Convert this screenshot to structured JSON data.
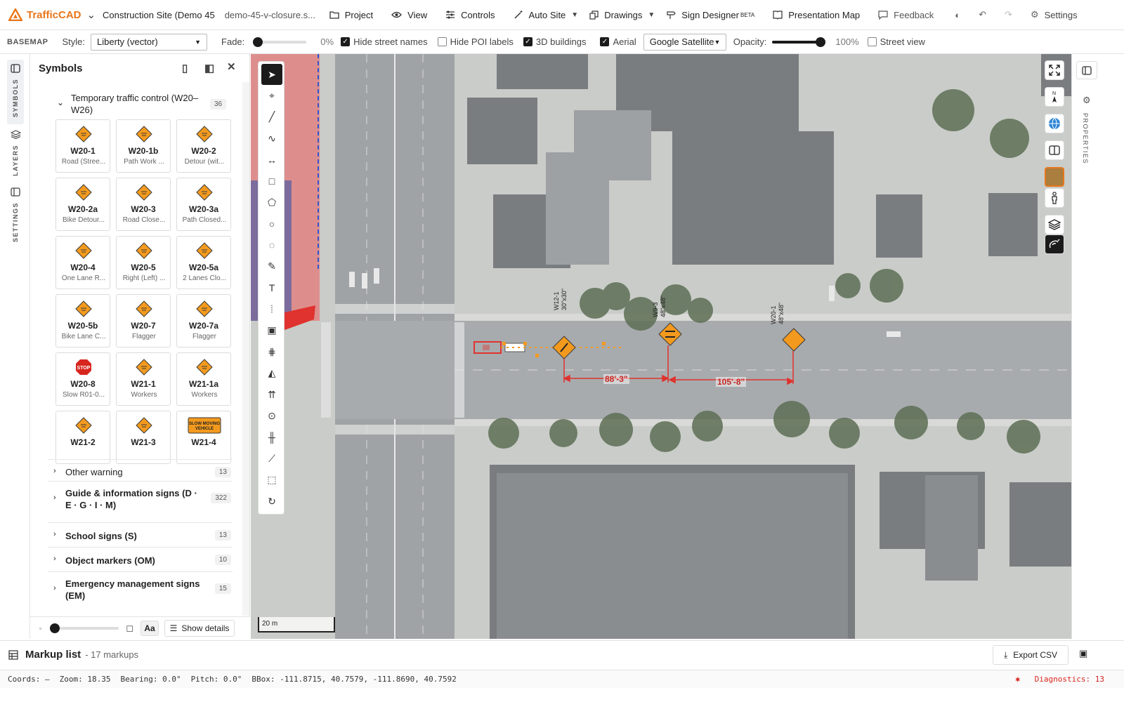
{
  "app": {
    "name": "TrafficCAD",
    "project_title": "Construction Site (Demo 45",
    "project_file": "demo-45-v-closure.s..."
  },
  "menu": [
    {
      "label": "Project",
      "icon": "folder-icon"
    },
    {
      "label": "View",
      "icon": "eye-icon"
    },
    {
      "label": "Controls",
      "icon": "sliders-icon"
    },
    {
      "label": "Auto Site",
      "icon": "wand-icon"
    },
    {
      "label": "Drawings",
      "icon": "copy-icon"
    },
    {
      "label": "Sign Designer",
      "icon": "sign-post-icon",
      "badge": "BETA"
    },
    {
      "label": "Presentation Map",
      "icon": "book-icon"
    },
    {
      "label": "Feedback",
      "icon": "message-icon"
    }
  ],
  "top_right": {
    "settings_label": "Settings"
  },
  "basemap": {
    "section_label": "BASEMAP",
    "style_label": "Style:",
    "style_value": "Liberty (vector)",
    "fade_label": "Fade:",
    "fade_value": "0%",
    "fade_fraction": 0,
    "hide_street_names": {
      "label": "Hide street names",
      "checked": true
    },
    "hide_poi_labels": {
      "label": "Hide POI labels",
      "checked": false
    },
    "buildings_3d": {
      "label": "3D buildings",
      "checked": true
    },
    "aerial": {
      "label": "Aerial",
      "checked": true
    },
    "aerial_source": "Google Satellite",
    "opacity_label": "Opacity:",
    "opacity_value": "100%",
    "opacity_fraction": 1,
    "street_view": {
      "label": "Street view",
      "checked": false
    }
  },
  "rail": {
    "symbols": "SYMBOLS",
    "layers": "LAYERS",
    "settings": "SETTINGS"
  },
  "symbols_panel": {
    "title": "Symbols",
    "open_group": {
      "label": "Temporary traffic control (W20–W26)",
      "count": "36"
    },
    "signs": [
      {
        "code": "W20-1",
        "desc": "Road (Stree...",
        "text": "ROAD WORK AHEAD"
      },
      {
        "code": "W20-1b",
        "desc": "Path Work ...",
        "text": "PATH WORK AHEAD"
      },
      {
        "code": "W20-2",
        "desc": "Detour (wit...",
        "text": "DETOUR AHEAD"
      },
      {
        "code": "W20-2a",
        "desc": "Bike Detour...",
        "text": "BIKE DETOUR"
      },
      {
        "code": "W20-3",
        "desc": "Road Close...",
        "text": "ROAD CLOSED AHEAD"
      },
      {
        "code": "W20-3a",
        "desc": "Path Closed...",
        "text": "PATH CLOSED"
      },
      {
        "code": "W20-4",
        "desc": "One Lane R...",
        "text": "ONE LANE ROAD"
      },
      {
        "code": "W20-5",
        "desc": "Right (Left) ...",
        "text": "RIGHT LANE CLOSED"
      },
      {
        "code": "W20-5a",
        "desc": "2 Lanes Clo...",
        "text": "2 LANES CLOSED"
      },
      {
        "code": "W20-5b",
        "desc": "Bike Lane C...",
        "text": "BIKE LANE CLOSED"
      },
      {
        "code": "W20-7",
        "desc": "Flagger",
        "text": ""
      },
      {
        "code": "W20-7a",
        "desc": "Flagger",
        "text": "FLAGGER"
      },
      {
        "code": "W20-8",
        "desc": "Slow R01-0...",
        "text": "STOP"
      },
      {
        "code": "W21-1",
        "desc": "Workers",
        "text": ""
      },
      {
        "code": "W21-1a",
        "desc": "Workers",
        "text": "WORKERS"
      },
      {
        "code": "W21-2",
        "desc": "",
        "text": "FRESH OIL"
      },
      {
        "code": "W21-3",
        "desc": "",
        "text": "ROAD MACHINERY"
      },
      {
        "code": "W21-4",
        "desc": "",
        "text": "SLOW MOVING VEHICLE"
      }
    ],
    "groups": [
      {
        "label": "Other warning",
        "count": "13"
      },
      {
        "label": "Guide & information signs (D · E · G · I · M)",
        "count": "322"
      },
      {
        "label": "School signs (S)",
        "count": "13"
      },
      {
        "label": "Object markers (OM)",
        "count": "10"
      },
      {
        "label": "Emergency management signs (EM)",
        "count": "15"
      }
    ],
    "footer": {
      "text_size_label": "Aa",
      "show_details_label": "Show details"
    }
  },
  "map": {
    "scale_label": "20 m",
    "sign_labels": [
      {
        "code": "W12-1",
        "size": "30\"x30\""
      },
      {
        "code": "W9-3",
        "size": "48\"x48\""
      },
      {
        "code": "W20-1",
        "size": "48\"x48\""
      }
    ],
    "dimensions": [
      "88'-3\"",
      "105'-8\""
    ]
  },
  "properties_label": "PROPERTIES",
  "markup": {
    "title": "Markup list",
    "count_text": "- 17 markups",
    "export_label": "Export CSV"
  },
  "status": {
    "coords": "Coords: —",
    "zoom": "Zoom: 18.35",
    "bearing": "Bearing: 0.0°",
    "pitch": "Pitch: 0.0°",
    "bbox": "BBox: -111.8715, 40.7579, -111.8690, 40.7592",
    "diagnostics": "Diagnostics: 13"
  },
  "colors": {
    "brand": "#e8761b",
    "sign_orange": "#f39a1e",
    "markup_red": "#e0322e",
    "stop_red": "#d7261e"
  }
}
